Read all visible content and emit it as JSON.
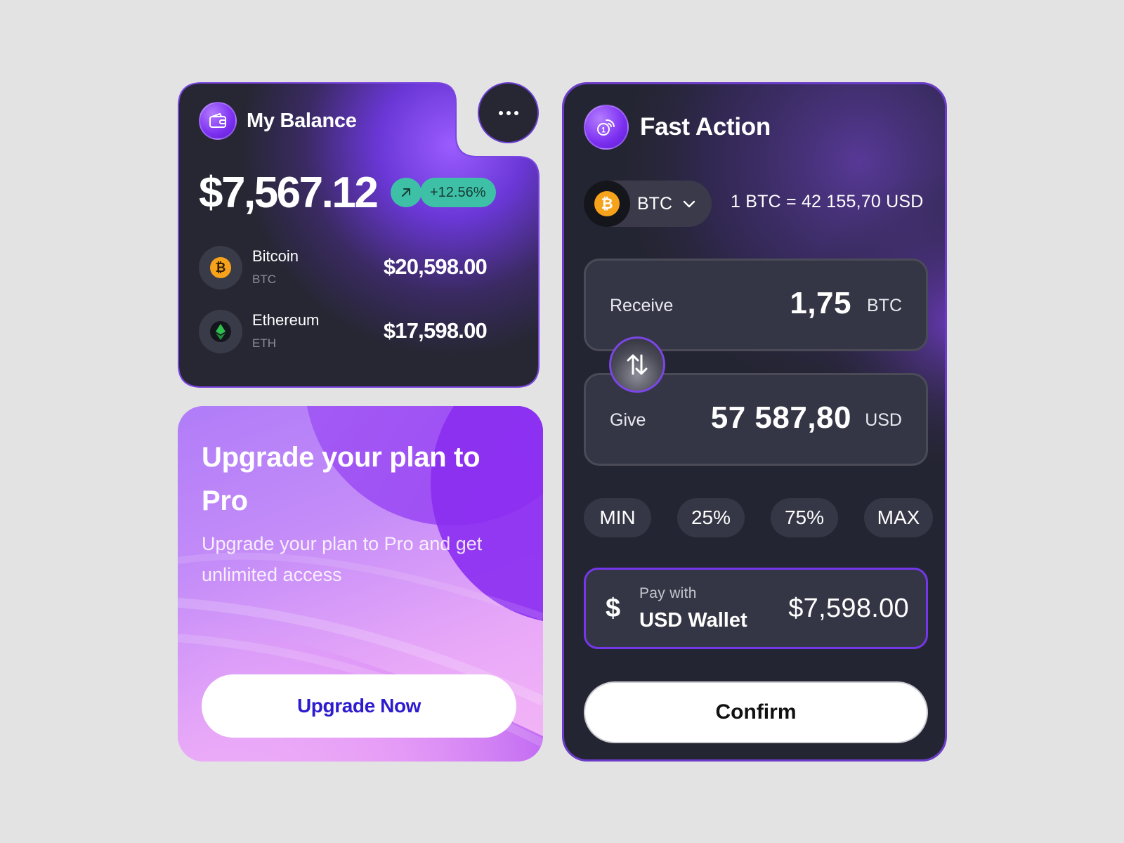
{
  "colors": {
    "background": "#e3e3e4",
    "card_dark": "#242532",
    "accent_purple": "#7b2ff0",
    "positive_green": "#3ec0a7",
    "upgrade_button_text": "#2d1ccf",
    "bitcoin_orange": "#f7a21b",
    "ethereum_green": "#2fbf4f"
  },
  "balance": {
    "title": "My Balance",
    "icon": "wallet-icon",
    "amount": "$7,567.12",
    "change": "+12.56%",
    "change_icon": "arrow-up-right-icon",
    "assets": [
      {
        "name": "Bitcoin",
        "symbol": "BTC",
        "value": "$20,598.00",
        "icon": "bitcoin-icon"
      },
      {
        "name": "Ethereum",
        "symbol": "ETH",
        "value": "$17,598.00",
        "icon": "ethereum-icon"
      }
    ],
    "more_icon": "more-horizontal-icon"
  },
  "upgrade": {
    "title": "Upgrade your plan to Pro",
    "subtitle": "Upgrade your plan to Pro and get unlimited access",
    "button": "Upgrade Now"
  },
  "fast_action": {
    "title": "Fast Action",
    "icon": "coins-exchange-icon",
    "selected_coin": "BTC",
    "rate": "1 BTC = 42 155,70 USD",
    "receive": {
      "label": "Receive",
      "value": "1,75",
      "currency": "BTC"
    },
    "give": {
      "label": "Give",
      "value": "57 587,80",
      "currency": "USD"
    },
    "presets": [
      "MIN",
      "25%",
      "75%",
      "MAX"
    ],
    "pay": {
      "label": "Pay with",
      "method": "USD Wallet",
      "amount": "$7,598.00",
      "symbol": "$"
    },
    "confirm": "Confirm"
  }
}
